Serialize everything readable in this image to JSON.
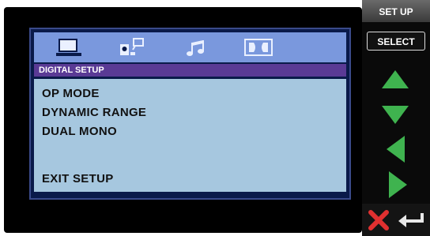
{
  "sidebar": {
    "setup_label": "SET UP",
    "select_label": "SELECT"
  },
  "osd": {
    "tabs": [
      {
        "icon": "monitor-icon"
      },
      {
        "icon": "speaker-icon"
      },
      {
        "icon": "music-note-icon"
      },
      {
        "icon": "dolby-digital-icon"
      }
    ],
    "title": "DIGITAL SETUP",
    "items": [
      {
        "label": "OP MODE"
      },
      {
        "label": "DYNAMIC RANGE"
      },
      {
        "label": "DUAL MONO"
      },
      {
        "label": "EXIT SETUP"
      }
    ]
  },
  "colors": {
    "tab_bar": "#7a98dd",
    "title_bar": "#5a3a95",
    "menu_bg": "#a6c7df",
    "arrow_green": "#3fb34f",
    "close_red": "#e03030"
  }
}
